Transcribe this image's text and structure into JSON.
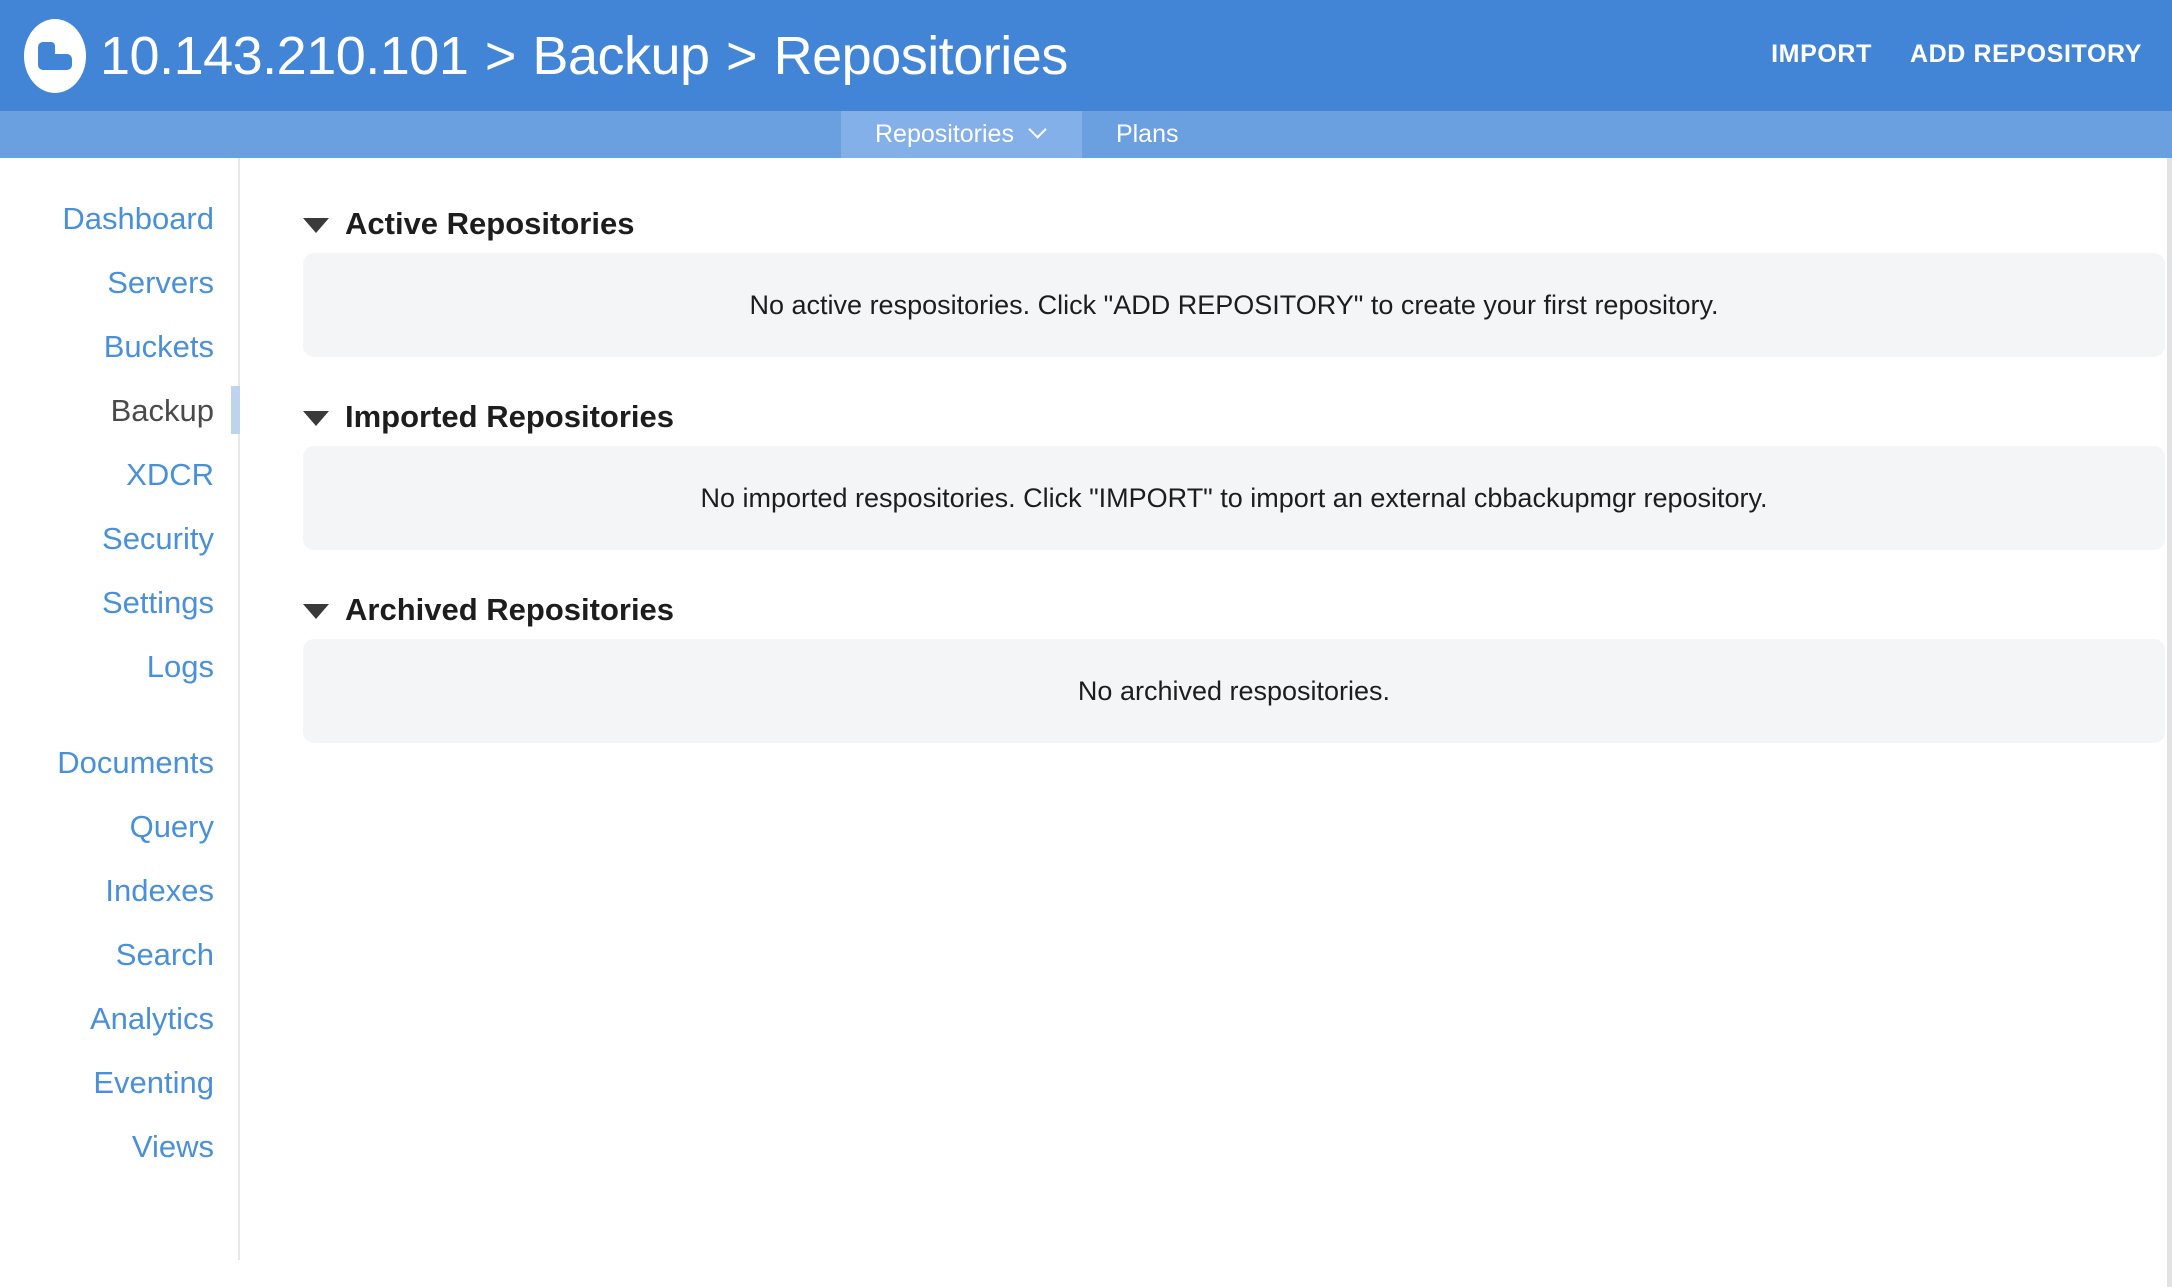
{
  "header": {
    "logo_icon": "couchbase-logo-icon",
    "breadcrumb": {
      "host": "10.143.210.101",
      "separator_1": " > ",
      "section": "Backup",
      "separator_2": " > ",
      "page": "Repositories"
    },
    "actions": [
      {
        "label": "IMPORT",
        "name": "import-button"
      },
      {
        "label": "ADD REPOSITORY",
        "name": "add-repository-button"
      }
    ],
    "colors": {
      "background": "#4285D6",
      "text": "#FFFFFF"
    }
  },
  "tabbar": {
    "background": "#6BA0E0",
    "active_background": "#83B0E8",
    "tabs": [
      {
        "label": "Repositories",
        "active": true,
        "has_chevron": true,
        "chevron_icon": "chevron-down-icon"
      },
      {
        "label": "Plans",
        "active": false,
        "has_chevron": false
      }
    ]
  },
  "sidebar": {
    "active_item": "Backup",
    "link_color": "#4A90D9",
    "active_color": "#4A4A4A",
    "active_indicator_color": "#BDD3EE",
    "group_1": [
      {
        "label": "Dashboard",
        "name": "sidebar-item-dashboard"
      },
      {
        "label": "Servers",
        "name": "sidebar-item-servers"
      },
      {
        "label": "Buckets",
        "name": "sidebar-item-buckets"
      },
      {
        "label": "Backup",
        "name": "sidebar-item-backup"
      },
      {
        "label": "XDCR",
        "name": "sidebar-item-xdcr"
      },
      {
        "label": "Security",
        "name": "sidebar-item-security"
      },
      {
        "label": "Settings",
        "name": "sidebar-item-settings"
      },
      {
        "label": "Logs",
        "name": "sidebar-item-logs"
      }
    ],
    "group_2": [
      {
        "label": "Documents",
        "name": "sidebar-item-documents"
      },
      {
        "label": "Query",
        "name": "sidebar-item-query"
      },
      {
        "label": "Indexes",
        "name": "sidebar-item-indexes"
      },
      {
        "label": "Search",
        "name": "sidebar-item-search"
      },
      {
        "label": "Analytics",
        "name": "sidebar-item-analytics"
      },
      {
        "label": "Eventing",
        "name": "sidebar-item-eventing"
      },
      {
        "label": "Views",
        "name": "sidebar-item-views"
      }
    ]
  },
  "main": {
    "panel_background": "#F4F5F7",
    "sections": [
      {
        "title": "Active Repositories",
        "expanded": true,
        "caret_icon": "caret-down-icon",
        "empty_message": "No active respositories. Click \"ADD REPOSITORY\" to create your first repository."
      },
      {
        "title": "Imported Repositories",
        "expanded": true,
        "caret_icon": "caret-down-icon",
        "empty_message": "No imported respositories. Click \"IMPORT\" to import an external cbbackupmgr repository."
      },
      {
        "title": "Archived Repositories",
        "expanded": true,
        "caret_icon": "caret-down-icon",
        "empty_message": "No archived respositories."
      }
    ]
  }
}
